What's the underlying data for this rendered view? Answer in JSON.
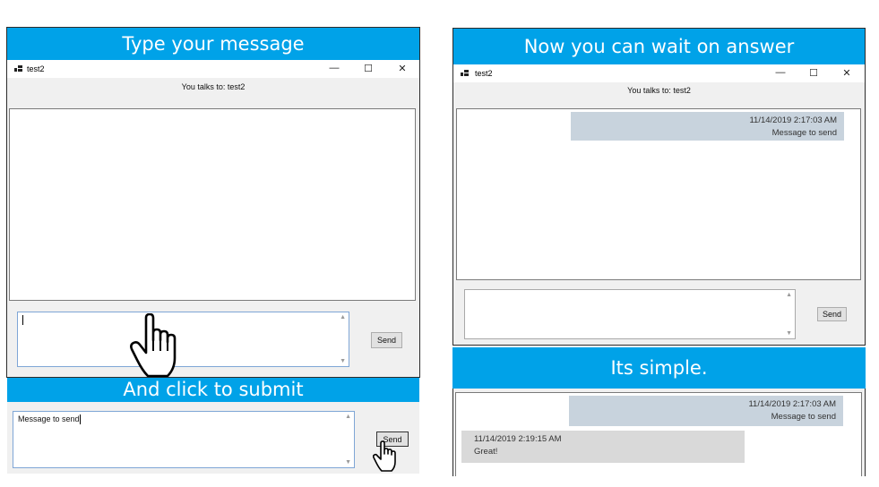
{
  "left": {
    "banner_top": "Type your message",
    "banner_bottom": "And click to submit",
    "window_title": "test2",
    "talks_to": "You talks to: test2",
    "input_value": "",
    "send_label": "Send",
    "bottom_input_value": "Message to send",
    "bottom_send_label": "Send"
  },
  "right": {
    "banner_top": "Now you can wait on answer",
    "banner_middle": "Its simple.",
    "window_title": "test2",
    "talks_to": "You talks to: test2",
    "send_label": "Send",
    "messages_top": [
      {
        "timestamp": "11/14/2019 2:17:03 AM",
        "text": "Message to send"
      }
    ],
    "messages_bottom": [
      {
        "timestamp": "11/14/2019 2:17:03 AM",
        "text": "Message to send"
      },
      {
        "timestamp": "11/14/2019 2:19:15 AM",
        "text": "Great!"
      }
    ]
  },
  "controls": {
    "minimize": "—",
    "maximize": "☐",
    "close": "✕"
  },
  "colors": {
    "banner": "#00a2e8",
    "sent_bubble": "#c8d3dd",
    "received_bubble": "#d9d9d9"
  },
  "icons": [
    "window-icon",
    "hand-cursor-icon",
    "scroll-up-icon",
    "scroll-down-icon"
  ]
}
